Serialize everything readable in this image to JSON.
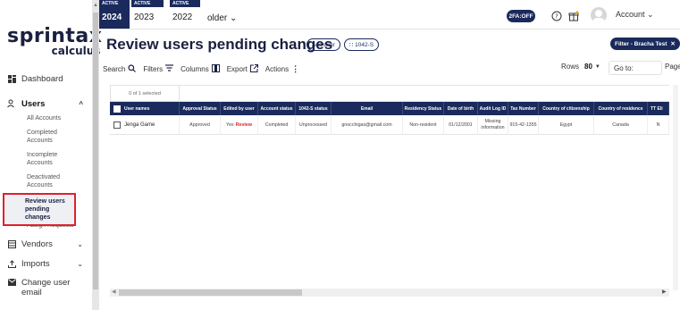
{
  "brand": {
    "name": "sprintax",
    "sub": "calculus"
  },
  "sidebar": {
    "dashboard": "Dashboard",
    "users": "Users",
    "users_sub": [
      "All Accounts",
      "Completed Accounts",
      "Incomplete Accounts",
      "Deactivated Accounts"
    ],
    "selected": "Review users pending changes",
    "assign": "Assign Requests",
    "vendors": "Vendors",
    "imports": "Imports",
    "change_email": "Change user email"
  },
  "topbar": {
    "years": [
      {
        "badge": "ACTIVE",
        "year": "2024"
      },
      {
        "badge": "ACTIVE",
        "year": "2023"
      },
      {
        "badge": "ACTIVE",
        "year": "2022"
      }
    ],
    "older": "older",
    "twofa": "2FA:OFF",
    "account": "Account"
  },
  "page": {
    "title": "Review users pending changes",
    "add_user": "Add user",
    "form_1042s": "1042-S",
    "filter_chip": "Filter - Bracha Test"
  },
  "toolbar": {
    "search": "Search",
    "filters": "Filters",
    "columns": "Columns",
    "export": "Export",
    "actions": "Actions",
    "rows_label": "Rows",
    "rows_value": "80",
    "goto": "Go to:",
    "page": "Page:"
  },
  "table": {
    "selected_count": "0 of 1 selected",
    "headers": [
      "User names",
      "Approval Status",
      "Edited by user",
      "Account status",
      "1042-S status",
      "Email",
      "Residency Status",
      "Date of birth",
      "Audit Log ID",
      "Tax Number",
      "Country of citizenship",
      "Country of residence",
      "TT Eli"
    ],
    "rows": [
      {
        "name": "Jenga Game",
        "approval": "Approved",
        "edited": "Yes",
        "review": "Review",
        "account": "Completed",
        "status_1042s": "Unprocessed",
        "email": "gnocchigas@gmail.com",
        "residency": "Non-resident",
        "dob": "01/12/2001",
        "audit": "Missing information",
        "tax": "915-42-1355",
        "citizenship": "Egypt",
        "residence": "Canada",
        "tt": "N"
      }
    ]
  },
  "colors": {
    "navy": "#1a2a5c",
    "accent_red": "#e0202b"
  },
  "icons": [
    "dashboard-icon",
    "users-icon",
    "vendors-icon",
    "imports-icon",
    "mail-icon",
    "help-icon",
    "gift-icon",
    "search-icon",
    "filter-icon",
    "columns-icon",
    "export-icon",
    "more-icon"
  ]
}
